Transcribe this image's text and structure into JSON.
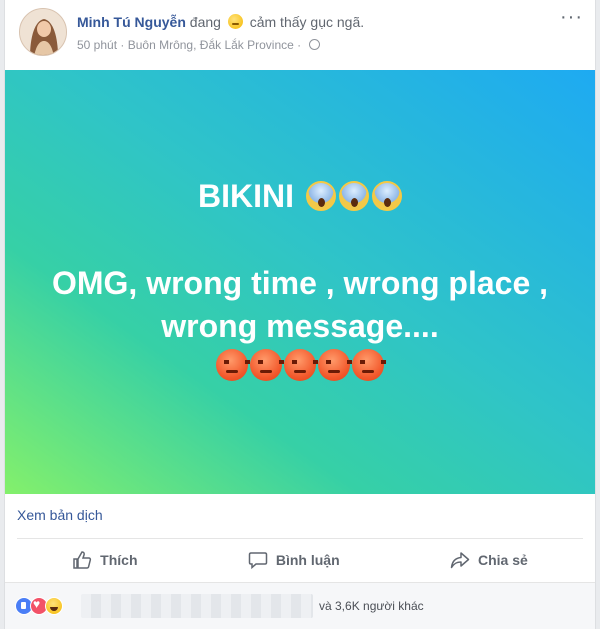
{
  "post": {
    "author": "Minh Tú Nguyễn",
    "feeling_prefix": "đang",
    "feeling_text": "cảm thấy gục ngã.",
    "time": "50 phút",
    "separator": "·",
    "location": "Buôn Mrông, Đắk Lắk Province",
    "more_label": "···"
  },
  "banner": {
    "line1": "BIKINI",
    "line2": "OMG, wrong time , wrong place , wrong message....",
    "scream_count": 3,
    "angry_count": 5,
    "gradient_colors": [
      "#84f06b",
      "#36d0a6",
      "#2fc4c8",
      "#1eaaf2"
    ]
  },
  "translate_link": "Xem bản dịch",
  "actions": {
    "like": "Thích",
    "comment": "Bình luận",
    "share": "Chia sẻ"
  },
  "reactions": {
    "icons": [
      "like-reaction-icon",
      "love-reaction-icon",
      "haha-reaction-icon"
    ],
    "others_text": "và 3,6K người khác"
  },
  "colors": {
    "link": "#365899",
    "secondary_text": "#90949c",
    "action_text": "#616770"
  }
}
